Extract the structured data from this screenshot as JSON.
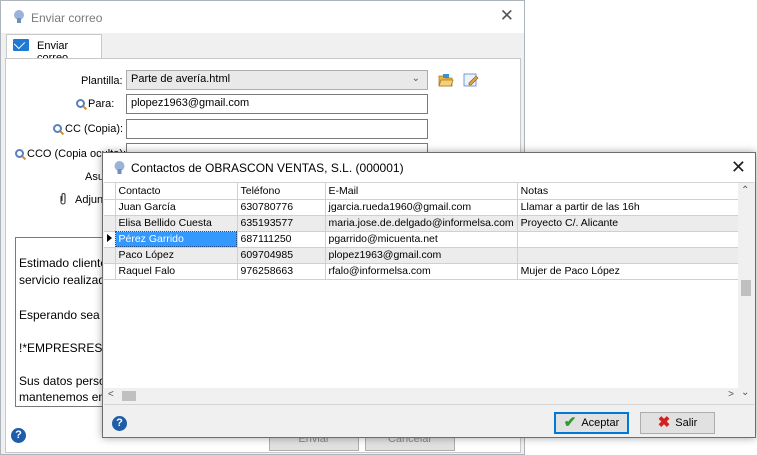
{
  "back_window": {
    "title": "Enviar correo",
    "tab_label": "Enviar correo",
    "fields": {
      "plantilla_label": "Plantilla:",
      "plantilla_value": "Parte de avería.html",
      "para_label": "Para:",
      "para_value": "plopez1963@gmail.com",
      "cc_label": "CC (Copia):",
      "cc_value": "",
      "cco_label": "CCO (Copia oculta):",
      "cco_value": "",
      "asunto_label": "Asu",
      "adjuntos_label": "Adjun"
    },
    "body_lines": [
      "Estimado cliente",
      "servicio realizad",
      "Esperando sea",
      "!*EMPRESRES",
      "Sus datos perso",
      "mantenemos en"
    ],
    "footer_buttons": [
      "Enviar",
      "Cancelar"
    ]
  },
  "dialog": {
    "title": "Contactos de  OBRASCON VENTAS, S.L. (000001)",
    "columns": [
      "Contacto",
      "Teléfono",
      "E-Mail",
      "Notas"
    ],
    "rows": [
      {
        "contacto": "Juan García",
        "telefono": "630780776",
        "email": "jgarcia.rueda1960@gmail.com",
        "notas": "Llamar a partir de las 16h"
      },
      {
        "contacto": "Elisa Bellido Cuesta",
        "telefono": "635193577",
        "email": "maria.jose.de.delgado@informelsa.com",
        "notas": "Proyecto C/. Alicante"
      },
      {
        "contacto": "Pérez Garrido",
        "telefono": "687111250",
        "email": "pgarrido@micuenta.net",
        "notas": ""
      },
      {
        "contacto": "Paco López",
        "telefono": "609704985",
        "email": "plopez1963@gmail.com",
        "notas": ""
      },
      {
        "contacto": "Raquel Falo",
        "telefono": "976258663",
        "email": "rfalo@informelsa.com",
        "notas": "Mujer de Paco López"
      }
    ],
    "selected_row": 2,
    "buttons": {
      "accept": "Aceptar",
      "exit": "Salir"
    }
  },
  "icons": [
    "envelope-icon",
    "search-icon",
    "paperclip-icon",
    "folder-open-icon",
    "edit-icon",
    "help-icon",
    "check-icon",
    "x-icon"
  ],
  "colors": {
    "selection": "#3399ff",
    "accept_check": "#2e9b2e",
    "exit_x": "#d42020",
    "help": "#1f5da8"
  }
}
